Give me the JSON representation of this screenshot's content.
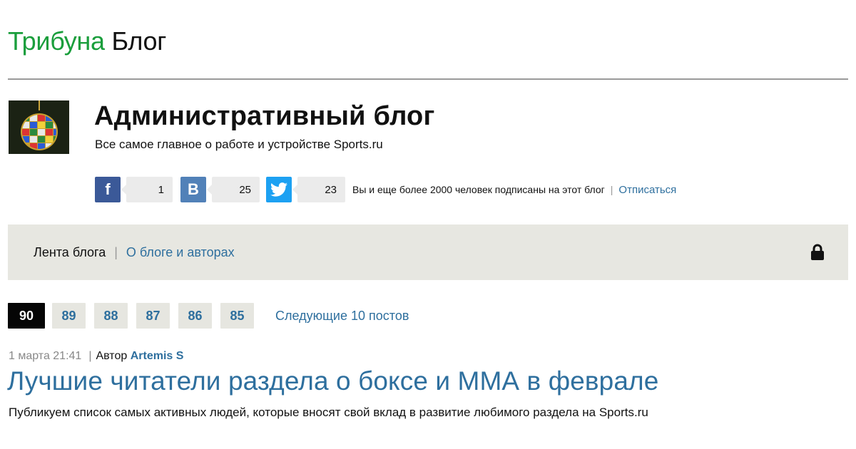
{
  "brand": {
    "part1": "Трибуна",
    "part2": "Блог"
  },
  "blog": {
    "title": "Административный блог",
    "subtitle": "Все самое главное о работе и устройстве Sports.ru"
  },
  "share": {
    "facebook": {
      "icon": "facebook-icon",
      "count": "1"
    },
    "vk": {
      "icon": "vk-icon",
      "count": "25"
    },
    "twitter": {
      "icon": "twitter-icon",
      "count": "23"
    },
    "subscribers_text": "Вы и еще более 2000 человек подписаны на этот блог",
    "unsubscribe_label": "Отписаться"
  },
  "nav": {
    "feed_label": "Лента блога",
    "about_label": "О блоге и авторах",
    "lock_icon": "lock-icon"
  },
  "pagination": {
    "pages": [
      "90",
      "89",
      "88",
      "87",
      "86",
      "85"
    ],
    "active": "90",
    "next_label": "Следующие 10 постов"
  },
  "post": {
    "date": "1 марта 21:41",
    "author_prefix": "Автор",
    "author": "Artemis S",
    "title": "Лучшие читатели раздела о боксе и ММА в феврале",
    "excerpt": "Публикуем список самых активных людей, которые вносят свой вклад в развитие любимого раздела на Sports.ru"
  },
  "colors": {
    "brand_green": "#1a9e3c",
    "link_blue": "#2e6f9e",
    "facebook": "#3b5998",
    "vk": "#5181b8",
    "twitter": "#1da1f2",
    "nav_bg": "#e7e7e1"
  }
}
